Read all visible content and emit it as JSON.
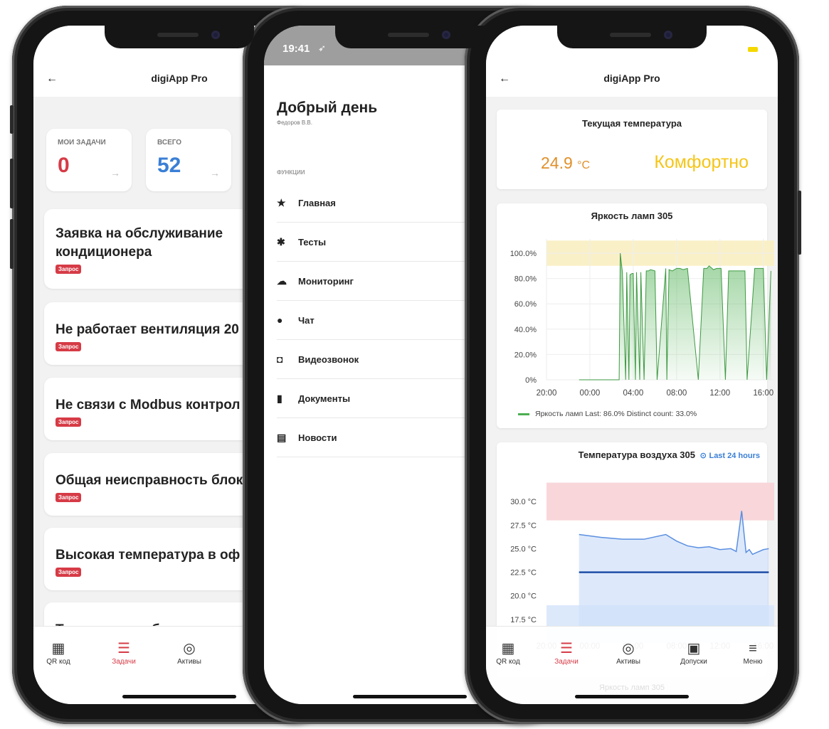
{
  "colors": {
    "accent": "#d63b46",
    "blue": "#3a7fd6",
    "orange": "#e0902a",
    "yellow": "#f5c518",
    "green": "#4caf50"
  },
  "phone1": {
    "app_title": "digiApp Pro",
    "back_icon": "arrow-left-icon",
    "stats": [
      {
        "label": "МОИ ЗАДАЧИ",
        "value": "0"
      },
      {
        "label": "ВСЕГО",
        "value": "52"
      }
    ],
    "tasks": [
      {
        "title": "Заявка на обслуживание кондиционера",
        "badge": "Запрос"
      },
      {
        "title": "Не работает вентиляция 20",
        "badge": "Запрос"
      },
      {
        "title": "Не связи с Modbus контрол",
        "badge": "Запрос"
      },
      {
        "title": "Общая неисправность блок",
        "badge": "Запрос"
      },
      {
        "title": "Высокая температура в оф",
        "badge": "Запрос"
      },
      {
        "title": "Техническое обслуживание",
        "badge": ""
      }
    ],
    "tabs": [
      {
        "label": "QR код",
        "icon": "qr-icon"
      },
      {
        "label": "Задачи",
        "icon": "tasks-icon"
      },
      {
        "label": "Активы",
        "icon": "target-icon"
      }
    ]
  },
  "phone2": {
    "time": "19:41",
    "greeting": "Добрый день",
    "user": "Федоров В.В.",
    "section": "ФУНКЦИИ",
    "items": [
      {
        "label": "Главная",
        "icon": "star-icon"
      },
      {
        "label": "Тесты",
        "icon": "gear-icon"
      },
      {
        "label": "Мониторинг",
        "icon": "cloud-icon"
      },
      {
        "label": "Чат",
        "icon": "chat-icon"
      },
      {
        "label": "Видеозвонок",
        "icon": "camera-icon"
      },
      {
        "label": "Документы",
        "icon": "document-icon"
      },
      {
        "label": "Новости",
        "icon": "news-icon"
      }
    ]
  },
  "phone3": {
    "app_title": "digiApp Pro",
    "temp_card": {
      "title": "Текущая температура",
      "value": "24.9",
      "unit": "°C",
      "status": "Комфортно"
    },
    "tabs": [
      {
        "label": "QR код",
        "icon": "qr-icon"
      },
      {
        "label": "Задачи",
        "icon": "tasks-icon"
      },
      {
        "label": "Активы",
        "icon": "target-icon"
      },
      {
        "label": "Допуски",
        "icon": "id-card-icon"
      },
      {
        "label": "Меню",
        "icon": "menu-icon"
      }
    ],
    "bottom_faded": "Яркость ламп 305"
  },
  "chart_data": [
    {
      "type": "line",
      "title": "Яркость ламп 305",
      "x_ticks": [
        "20:00",
        "00:00",
        "04:00",
        "08:00",
        "12:00",
        "16:00"
      ],
      "y_ticks": [
        "0%",
        "20.0%",
        "40.0%",
        "60.0%",
        "80.0%",
        "100.0%"
      ],
      "ylim": [
        0,
        100
      ],
      "threshold_band": [
        90,
        110
      ],
      "series": [
        {
          "name": "Яркость ламп",
          "x": [
            3.0,
            6.7,
            6.8,
            7.0,
            7.3,
            7.4,
            7.6,
            7.7,
            7.9,
            8.0,
            8.2,
            8.3,
            8.6,
            8.7,
            9.0,
            9.2,
            9.4,
            9.6,
            10.0,
            10.2,
            11.0,
            11.1,
            11.3,
            11.6,
            12.0,
            12.3,
            12.6,
            13.0,
            14.0,
            14.5,
            14.8,
            15.0,
            15.4,
            15.7,
            16.1,
            16.5,
            16.8,
            17.6,
            18.3,
            18.5,
            19.2,
            20.0,
            20.3,
            20.7
          ],
          "y": [
            0,
            0,
            100,
            85,
            0,
            85,
            0,
            83,
            84,
            84,
            0,
            85,
            0,
            85,
            0,
            86,
            86,
            87,
            86,
            0,
            88,
            0,
            87,
            86,
            88,
            88,
            87,
            88,
            0,
            88,
            88,
            90,
            87,
            88,
            88,
            0,
            86,
            86,
            86,
            0,
            88,
            88,
            0,
            86
          ]
        }
      ],
      "legend": "Яркость ламп  Last: 86.0%  Distinct count: 33.0%"
    },
    {
      "type": "line",
      "title": "Температура воздуха 305",
      "time_range": "Last 24 hours",
      "x_ticks": [
        "20:00",
        "00:00",
        "04:00",
        "08:00",
        "12:00",
        "16:00"
      ],
      "y_ticks": [
        "17.5 °C",
        "20.0 °C",
        "22.5 °C",
        "25.0 °C",
        "27.5 °C",
        "30.0 °C"
      ],
      "ylim": [
        15,
        32.5
      ],
      "bands": [
        {
          "from": 28,
          "to": 32,
          "color": "red"
        },
        {
          "from": 15,
          "to": 19,
          "color": "blue"
        }
      ],
      "series": [
        {
          "name": "",
          "x": [
            3,
            5,
            7,
            9,
            11,
            12,
            13,
            14,
            15,
            16,
            17,
            17.5,
            18,
            18.4,
            18.7,
            19,
            19.4,
            20,
            20.5
          ],
          "y": [
            26.5,
            26.2,
            26.0,
            26.0,
            26.5,
            25.8,
            25.3,
            25.1,
            25.2,
            24.9,
            25.0,
            24.7,
            29.0,
            24.6,
            24.9,
            24.4,
            24.6,
            24.9,
            25.0
          ]
        },
        {
          "name": "",
          "x": [
            3,
            20.5
          ],
          "y": [
            22.5,
            22.5
          ]
        }
      ]
    }
  ]
}
